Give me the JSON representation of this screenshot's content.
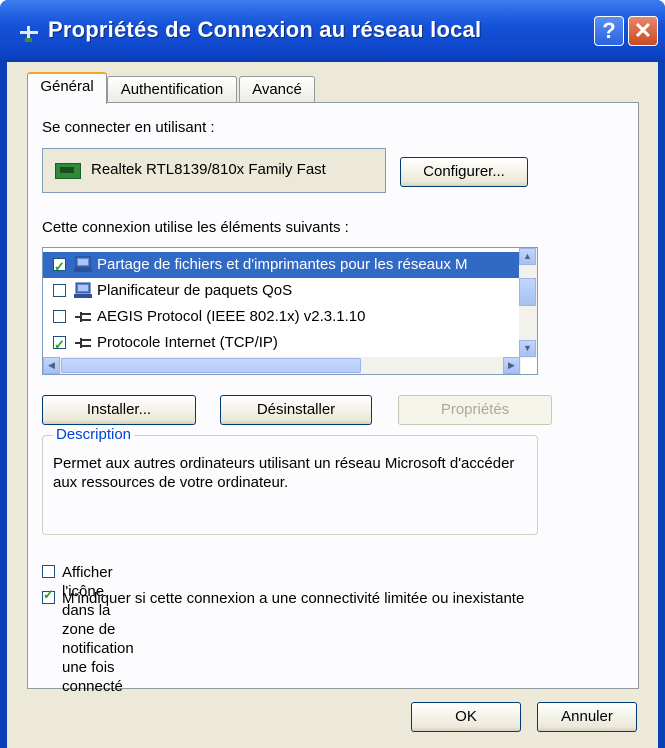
{
  "window": {
    "title": "Propriétés de Connexion au réseau local",
    "help_label": "?",
    "close_label": "✕"
  },
  "tabs": [
    {
      "label": "Général",
      "active": true
    },
    {
      "label": "Authentification",
      "active": false
    },
    {
      "label": "Avancé",
      "active": false
    }
  ],
  "general": {
    "connect_using_label": "Se connecter en utilisant :",
    "adapter_name": "Realtek RTL8139/810x Family Fast",
    "configure_label": "Configurer...",
    "components_label": "Cette connexion utilise les éléments suivants :",
    "components": [
      {
        "label": "Partage de fichiers et d'imprimantes pour les réseaux M",
        "checked": true,
        "selected": true,
        "icon": "network-service-icon"
      },
      {
        "label": "Planificateur de paquets QoS",
        "checked": false,
        "selected": false,
        "icon": "network-service-icon"
      },
      {
        "label": "AEGIS Protocol (IEEE 802.1x) v2.3.1.10",
        "checked": false,
        "selected": false,
        "icon": "protocol-icon"
      },
      {
        "label": "Protocole Internet (TCP/IP)",
        "checked": true,
        "selected": false,
        "icon": "protocol-icon"
      }
    ],
    "install_label": "Installer...",
    "uninstall_label": "Désinstaller",
    "properties_label": "Propriétés",
    "description_legend": "Description",
    "description_text": "Permet aux autres ordinateurs utilisant un réseau Microsoft d'accéder aux ressources de votre ordinateur.",
    "show_icon_label": "Afficher l'icône dans la zone de notification une fois connecté",
    "show_icon_checked": false,
    "notify_limited_label": "M'indiquer si cette connexion a une connectivité limitée ou inexistante",
    "notify_limited_checked": true
  },
  "buttons": {
    "ok_label": "OK",
    "cancel_label": "Annuler"
  }
}
